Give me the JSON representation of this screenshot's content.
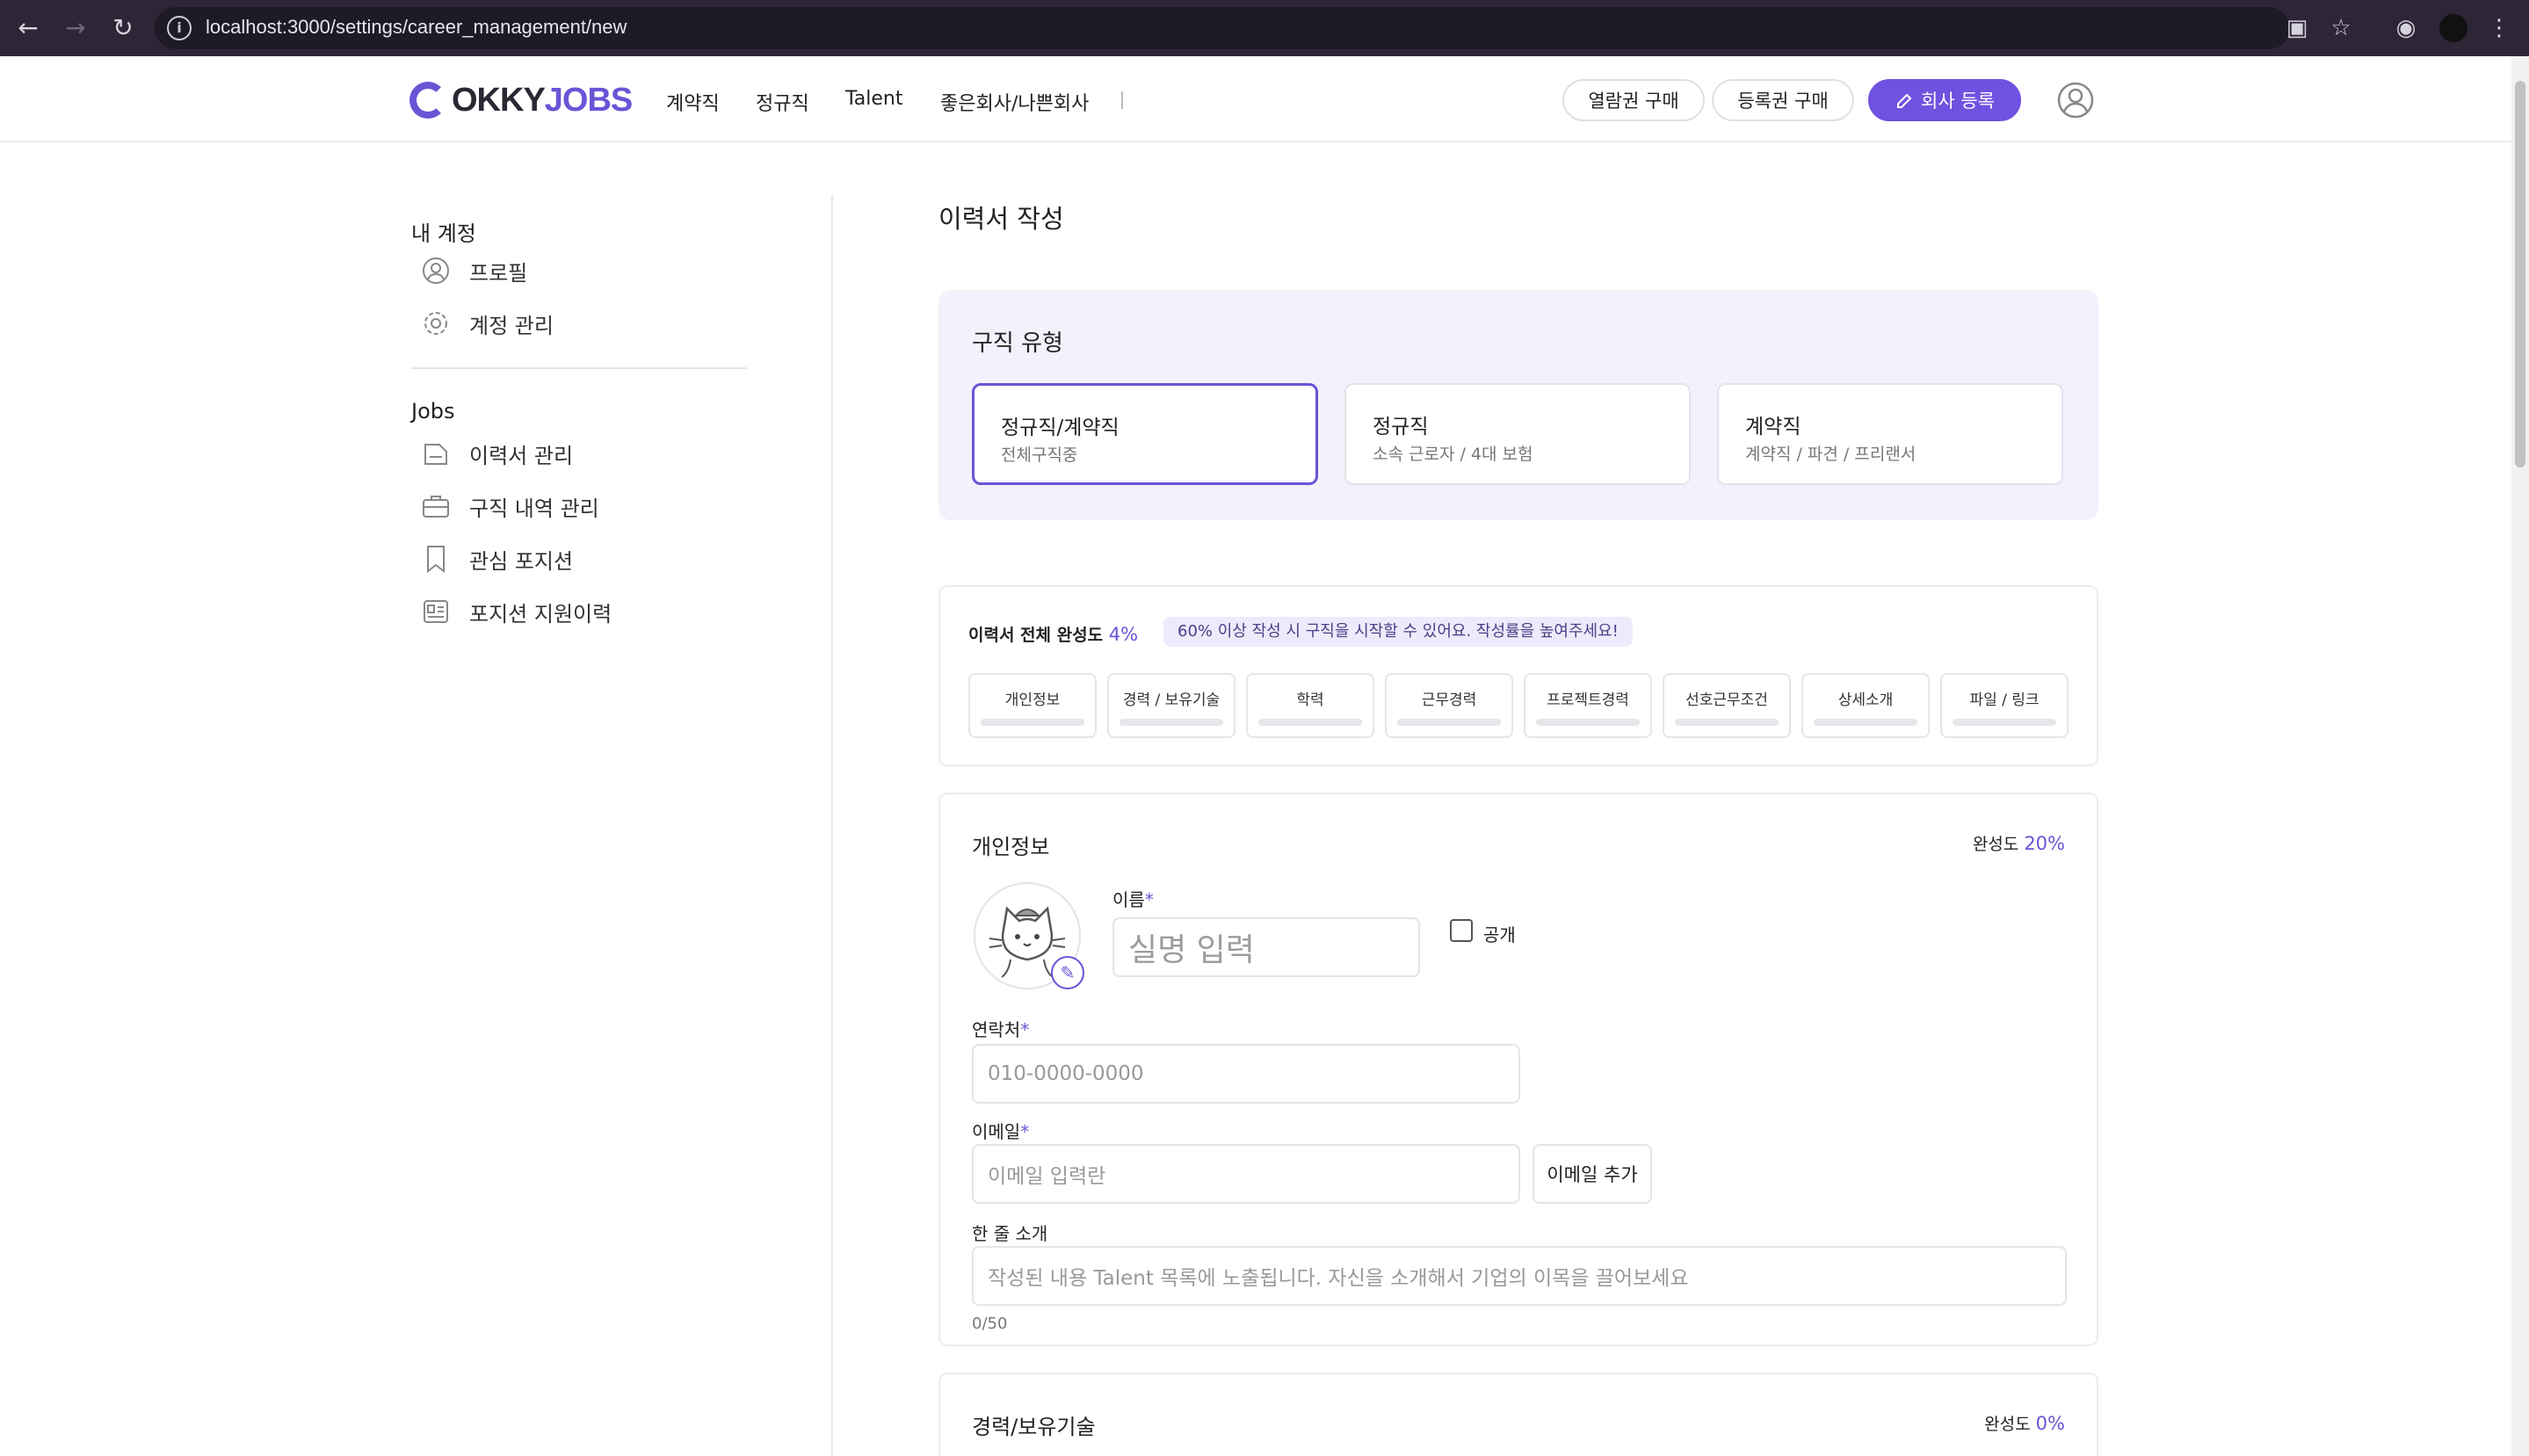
{
  "browser": {
    "url": "localhost:3000/settings/career_management/new"
  },
  "header": {
    "logo_okky": "OKKY",
    "logo_jobs": "JOBS",
    "nav": [
      "계약직",
      "정규직",
      "Talent",
      "좋은회사/나쁜회사"
    ],
    "btn_view_pass": "열람권 구매",
    "btn_reg_pass": "등록권 구매",
    "btn_company_reg": "회사 등록"
  },
  "sidebar": {
    "account_head": "내 계정",
    "account_items": [
      {
        "label": "프로필",
        "icon": "user-circle-icon"
      },
      {
        "label": "계정 관리",
        "icon": "gear-icon"
      }
    ],
    "jobs_head": "Jobs",
    "jobs_items": [
      {
        "label": "이력서 관리",
        "icon": "document-icon"
      },
      {
        "label": "구직 내역 관리",
        "icon": "briefcase-icon"
      },
      {
        "label": "관심 포지션",
        "icon": "bookmark-icon"
      },
      {
        "label": "포지션 지원이력",
        "icon": "id-card-icon"
      }
    ]
  },
  "main": {
    "title": "이력서 작성",
    "job_type": {
      "label": "구직 유형",
      "options": [
        {
          "title": "정규직/계약직",
          "sub": "전체구직중",
          "selected": true
        },
        {
          "title": "정규직",
          "sub": "소속 근로자 / 4대 보험",
          "selected": false
        },
        {
          "title": "계약직",
          "sub": "계약직 / 파견 / 프리랜서",
          "selected": false
        }
      ]
    },
    "progress": {
      "label": "이력서 전체 완성도",
      "percent": "4%",
      "hint": "60% 이상 작성 시 구직을 시작할 수 있어요. 작성률을 높여주세요!",
      "steps": [
        "개인정보",
        "경력 / 보유기술",
        "학력",
        "근무경력",
        "프로젝트경력",
        "선호근무조건",
        "상세소개",
        "파일 / 링크"
      ]
    },
    "personal": {
      "title": "개인정보",
      "completion_label": "완성도",
      "completion": "20%",
      "name_label": "이름",
      "required_mark": "*",
      "name_placeholder": "실명 입력",
      "public_label": "공개",
      "phone_label": "연락처",
      "phone_placeholder": "010-0000-0000",
      "email_label": "이메일",
      "email_placeholder": "이메일 입력란",
      "email_add": "이메일 추가",
      "intro_label": "한 줄 소개",
      "intro_placeholder": "작성된 내용 Talent 목록에 노출됩니다. 자신을 소개해서 기업의 이목을 끌어보세요",
      "intro_counter": "0/50"
    },
    "career": {
      "title": "경력/보유기술",
      "completion_label": "완성도",
      "completion": "0%"
    }
  },
  "colors": {
    "accent": "#6a54d6",
    "primary_button": "#7052e0",
    "type_box_bg": "#f4f0fc",
    "chrome_bg": "#2c2637"
  }
}
